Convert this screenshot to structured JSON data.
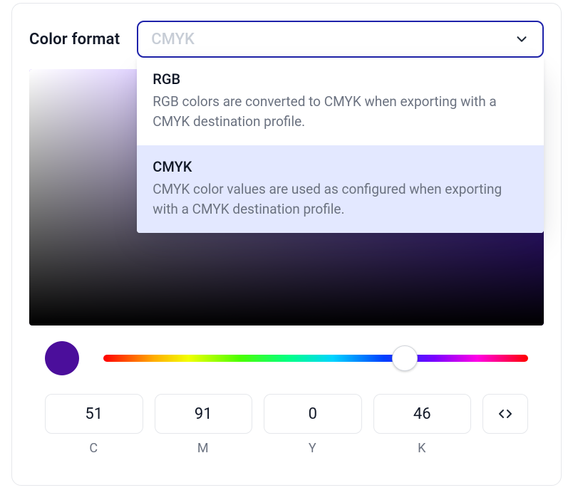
{
  "header": {
    "label": "Color format",
    "placeholder": "CMYK"
  },
  "options": [
    {
      "title": "RGB",
      "desc": "RGB colors are converted to CMYK when exporting with a CMYK destination profile.",
      "selected": false
    },
    {
      "title": "CMYK",
      "desc": "CMYK color values are used as configured when exporting with a CMYK destination profile.",
      "selected": true
    }
  ],
  "swatch_color": "#4b0e9b",
  "hue_thumb_percent": 71,
  "channels": [
    {
      "label": "C",
      "value": "51"
    },
    {
      "label": "M",
      "value": "91"
    },
    {
      "label": "Y",
      "value": "0"
    },
    {
      "label": "K",
      "value": "46"
    }
  ]
}
